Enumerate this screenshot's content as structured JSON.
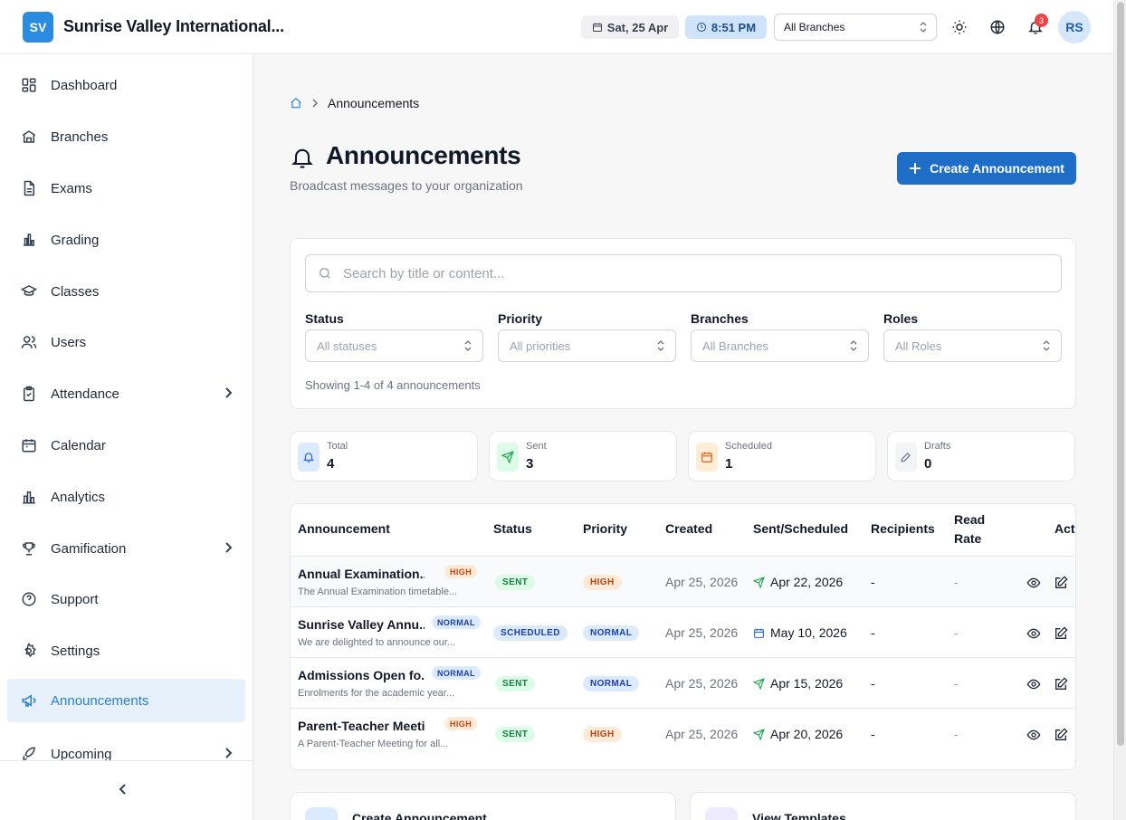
{
  "header": {
    "logo_initials": "SV",
    "org_name": "Sunrise Valley International...",
    "date": "Sat, 25 Apr",
    "time": "8:51 PM",
    "branch_select": "All Branches",
    "notification_count": "3",
    "user_initials": "RS"
  },
  "sidebar": {
    "items": [
      {
        "label": "Dashboard",
        "icon": "dashboard-icon"
      },
      {
        "label": "Branches",
        "icon": "building-icon"
      },
      {
        "label": "Exams",
        "icon": "document-icon"
      },
      {
        "label": "Grading",
        "icon": "bar-chart-icon"
      },
      {
        "label": "Classes",
        "icon": "graduation-cap-icon"
      },
      {
        "label": "Users",
        "icon": "users-icon"
      },
      {
        "label": "Attendance",
        "icon": "clipboard-check-icon"
      },
      {
        "label": "Calendar",
        "icon": "calendar-icon"
      },
      {
        "label": "Analytics",
        "icon": "analytics-icon"
      },
      {
        "label": "Gamification",
        "icon": "trophy-icon"
      },
      {
        "label": "Support",
        "icon": "help-circle-icon"
      },
      {
        "label": "Settings",
        "icon": "gear-icon"
      },
      {
        "label": "Announcements",
        "icon": "megaphone-icon"
      },
      {
        "label": "Upcoming",
        "icon": "rocket-icon"
      }
    ],
    "active": "Announcements"
  },
  "breadcrumb": {
    "current": "Announcements"
  },
  "page": {
    "title": "Announcements",
    "subtitle": "Broadcast messages to your organization",
    "create_button": "Create Announcement"
  },
  "filters": {
    "search_placeholder": "Search by title or content...",
    "status_label": "Status",
    "status_value": "All statuses",
    "priority_label": "Priority",
    "priority_value": "All priorities",
    "branches_label": "Branches",
    "branches_value": "All Branches",
    "roles_label": "Roles",
    "roles_value": "All Roles",
    "showing": "Showing 1-4 of 4 announcements"
  },
  "stats": [
    {
      "label": "Total",
      "value": "4"
    },
    {
      "label": "Sent",
      "value": "3"
    },
    {
      "label": "Scheduled",
      "value": "1"
    },
    {
      "label": "Drafts",
      "value": "0"
    }
  ],
  "table": {
    "headers": [
      "Announcement",
      "Status",
      "Priority",
      "Created",
      "Sent/Scheduled",
      "Recipients",
      "Read Rate",
      "Acti"
    ],
    "rows": [
      {
        "title": "Annual Examination...",
        "title_badge": "HIGH",
        "desc": "The Annual Examination timetable...",
        "status": "SENT",
        "priority": "HIGH",
        "created": "Apr 25, 2026",
        "sent": "Apr 22, 2026",
        "sent_icon": "send-icon",
        "recipients": "-",
        "read_rate": "-"
      },
      {
        "title": "Sunrise Valley Annu...",
        "title_badge": "NORMAL",
        "desc": "We are delighted to announce our...",
        "status": "SCHEDULED",
        "priority": "NORMAL",
        "created": "Apr 25, 2026",
        "sent": "May 10, 2026",
        "sent_icon": "calendar-icon",
        "recipients": "-",
        "read_rate": "-"
      },
      {
        "title": "Admissions Open fo...",
        "title_badge": "NORMAL",
        "desc": "Enrolments for the academic year...",
        "status": "SENT",
        "priority": "NORMAL",
        "created": "Apr 25, 2026",
        "sent": "Apr 15, 2026",
        "sent_icon": "send-icon",
        "recipients": "-",
        "read_rate": "-"
      },
      {
        "title": "Parent-Teacher Meeti...",
        "title_badge": "HIGH",
        "desc": "A Parent-Teacher Meeting for all...",
        "status": "SENT",
        "priority": "HIGH",
        "created": "Apr 25, 2026",
        "sent": "Apr 20, 2026",
        "sent_icon": "send-icon",
        "recipients": "-",
        "read_rate": "-"
      }
    ]
  },
  "quick_actions": [
    {
      "label": "Create Announcement"
    },
    {
      "label": "View Templates"
    }
  ],
  "colors": {
    "primary": "#1e6ec7",
    "accent": "#2a8be0",
    "sent_green": "#15803d",
    "high_orange": "#c2410c",
    "normal_blue": "#1e40af"
  }
}
